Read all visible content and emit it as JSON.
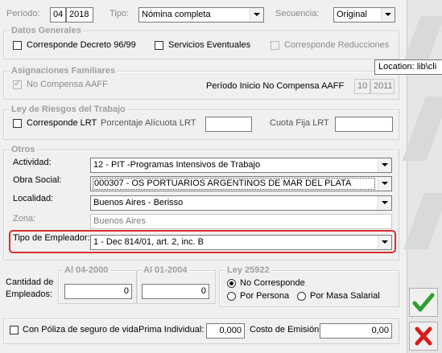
{
  "header": {
    "periodo_label": "Período:",
    "periodo_mes": "04",
    "periodo_anio": "2018",
    "tipo_label": "Tipo:",
    "tipo_value": "Nómina completa",
    "secuencia_label": "Secuencia:",
    "secuencia_value": "Original"
  },
  "datos_generales": {
    "legend": "Datos Generales",
    "decreto": "Corresponde Decreto 96/99",
    "servicios": "Servicios Eventuales",
    "reducciones": "Corresponde Reducciones"
  },
  "tooltip": "Location: lib\\cli",
  "asignaciones": {
    "legend": "Asignaciones Familiares",
    "no_compensa": "No Compensa AAFF",
    "periodo_inicio_label": "Período Inicio No Compensa AAFF",
    "periodo_mes": "10",
    "periodo_anio": "2011"
  },
  "lrt": {
    "legend": "Ley de Riesgos del Trabajo",
    "corresponde": "Corresponde LRT",
    "porcentaje_label": "Porcentaje Alícuota  LRT",
    "cuota_label": "Cuota Fija LRT"
  },
  "otros": {
    "legend": "Otros",
    "actividad_label": "Actividad:",
    "actividad_value": "12 - PIT -Programas  Intensivos de Trabajo",
    "obra_label": "Obra Social:",
    "obra_value": "000307 - OS  PORTUARIOS ARGENTINOS DE MAR DEL PLATA",
    "localidad_label": "Localidad:",
    "localidad_value": "Buenos Aires - Berisso",
    "zona_label": "Zona:",
    "zona_value": "Buenos Aires",
    "tipo_emp_label": "Tipo de Empleador:",
    "tipo_emp_value": "1 - Dec 814/01, art. 2, inc. B"
  },
  "empleados": {
    "al1_legend": "Al 04-2000",
    "al2_legend": "Al 01-2004",
    "cantidad_label_1": "Cantidad de",
    "cantidad_label_2": "Empleados:",
    "al1_value": "0",
    "al2_value": "0"
  },
  "ley25922": {
    "legend": "Ley 25922",
    "opt1": "No Corresponde",
    "opt2": "Por Persona",
    "opt3": "Por Masa Salarial"
  },
  "poliza": {
    "label": "Con Póliza de seguro de vida",
    "prima_label": "Prima Individual:",
    "prima_value": "0,000",
    "costo_label": "Costo de Emisión:",
    "costo_value": "0,00"
  },
  "colors": {
    "highlight": "#d93030",
    "ok": "#2e9e2e",
    "cancel": "#d81c1c",
    "selected_bg": "#3072c5"
  }
}
